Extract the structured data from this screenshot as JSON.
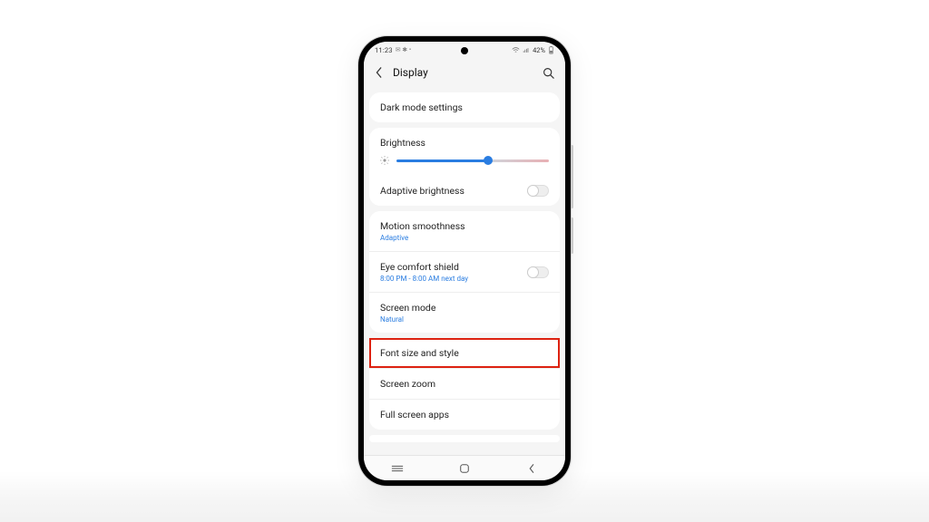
{
  "status": {
    "time": "11:23",
    "icons_left": "✉ ✱ •",
    "signal": "▫",
    "wifi": "⋰",
    "battery_pct": "42%",
    "battery_icon": "▯"
  },
  "header": {
    "title": "Display"
  },
  "rows": {
    "dark_mode": "Dark mode settings",
    "brightness_label": "Brightness",
    "adaptive_brightness": "Adaptive brightness",
    "motion": {
      "label": "Motion smoothness",
      "sub": "Adaptive"
    },
    "eye": {
      "label": "Eye comfort shield",
      "sub": "8:00 PM - 8:00 AM next day"
    },
    "screen_mode": {
      "label": "Screen mode",
      "sub": "Natural"
    },
    "font": "Font size and style",
    "zoom": "Screen zoom",
    "full": "Full screen apps"
  }
}
